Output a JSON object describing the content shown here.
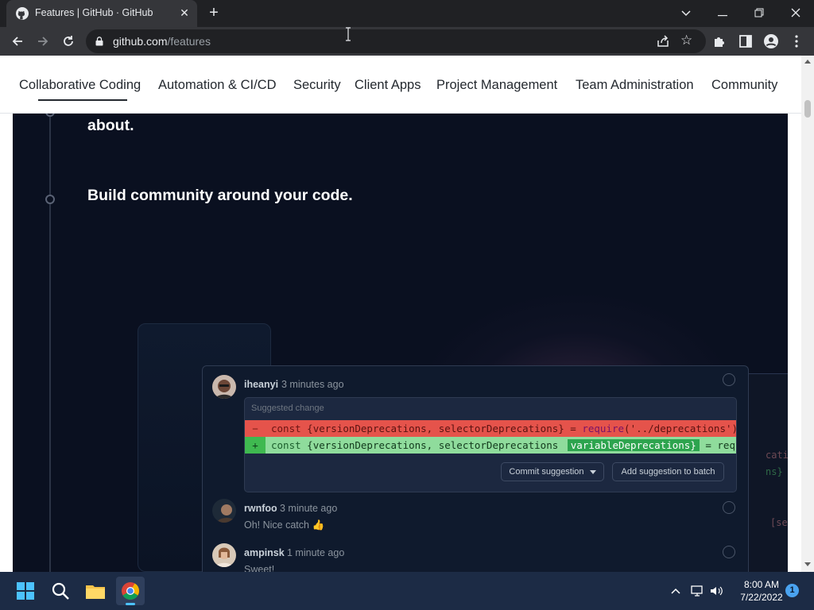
{
  "browser": {
    "tab_title": "Features | GitHub · GitHub",
    "tab_close": "✕",
    "new_tab": "+",
    "url_domain": "github.com",
    "url_path": "/features",
    "window_controls": {
      "dropdown": "⌄",
      "minimize": "—",
      "restore": "❐",
      "close": "✕"
    },
    "nav": {
      "back": "←",
      "forward": "→",
      "reload": "⟳"
    }
  },
  "subnav": {
    "items": [
      {
        "label": "Collaborative Coding",
        "active": true
      },
      {
        "label": "Automation & CI/CD"
      },
      {
        "label": "Security"
      },
      {
        "label": "Client Apps"
      },
      {
        "label": "Project Management"
      },
      {
        "label": "Team Administration"
      },
      {
        "label": "Community"
      }
    ]
  },
  "hero": {
    "headline_partial": "about.",
    "headline_2": "Build community around your code."
  },
  "comments": [
    {
      "author": "iheanyi",
      "time": "3 minutes ago"
    },
    {
      "author": "rwnfoo",
      "time": "3 minute ago",
      "message": "Oh! Nice catch 👍"
    },
    {
      "author": "ampinsk",
      "time": "1 minute ago",
      "message": "Sweet!"
    }
  ],
  "suggestion": {
    "label": "Suggested change",
    "removed": {
      "sign": "−",
      "kw": "const",
      "body": " {versionDeprecations, selectorDeprecations}",
      "eq": " = ",
      "fn": "require",
      "arg": "('../deprecations')"
    },
    "added": {
      "sign": "+",
      "kw": "const",
      "body": " {versionDeprecations, selectorDeprecations ",
      "hl": "variableDeprecations}",
      "rest": " = requi"
    },
    "commit_button": "Commit suggestion",
    "batch_button": "Add suggestion to batch"
  },
  "right_code": [
    "catio",
    "ns} =",
    "[sele"
  ],
  "taskbar": {
    "time": "8:00 AM",
    "date": "7/22/2022",
    "notification_count": "1"
  },
  "colors": {
    "page_dark_bg": "#0a1020",
    "diff_removed": "#e5534b",
    "diff_added": "#3fb950",
    "diff_added_highlight": "#2da44e",
    "taskbar": "#1c2b45"
  }
}
